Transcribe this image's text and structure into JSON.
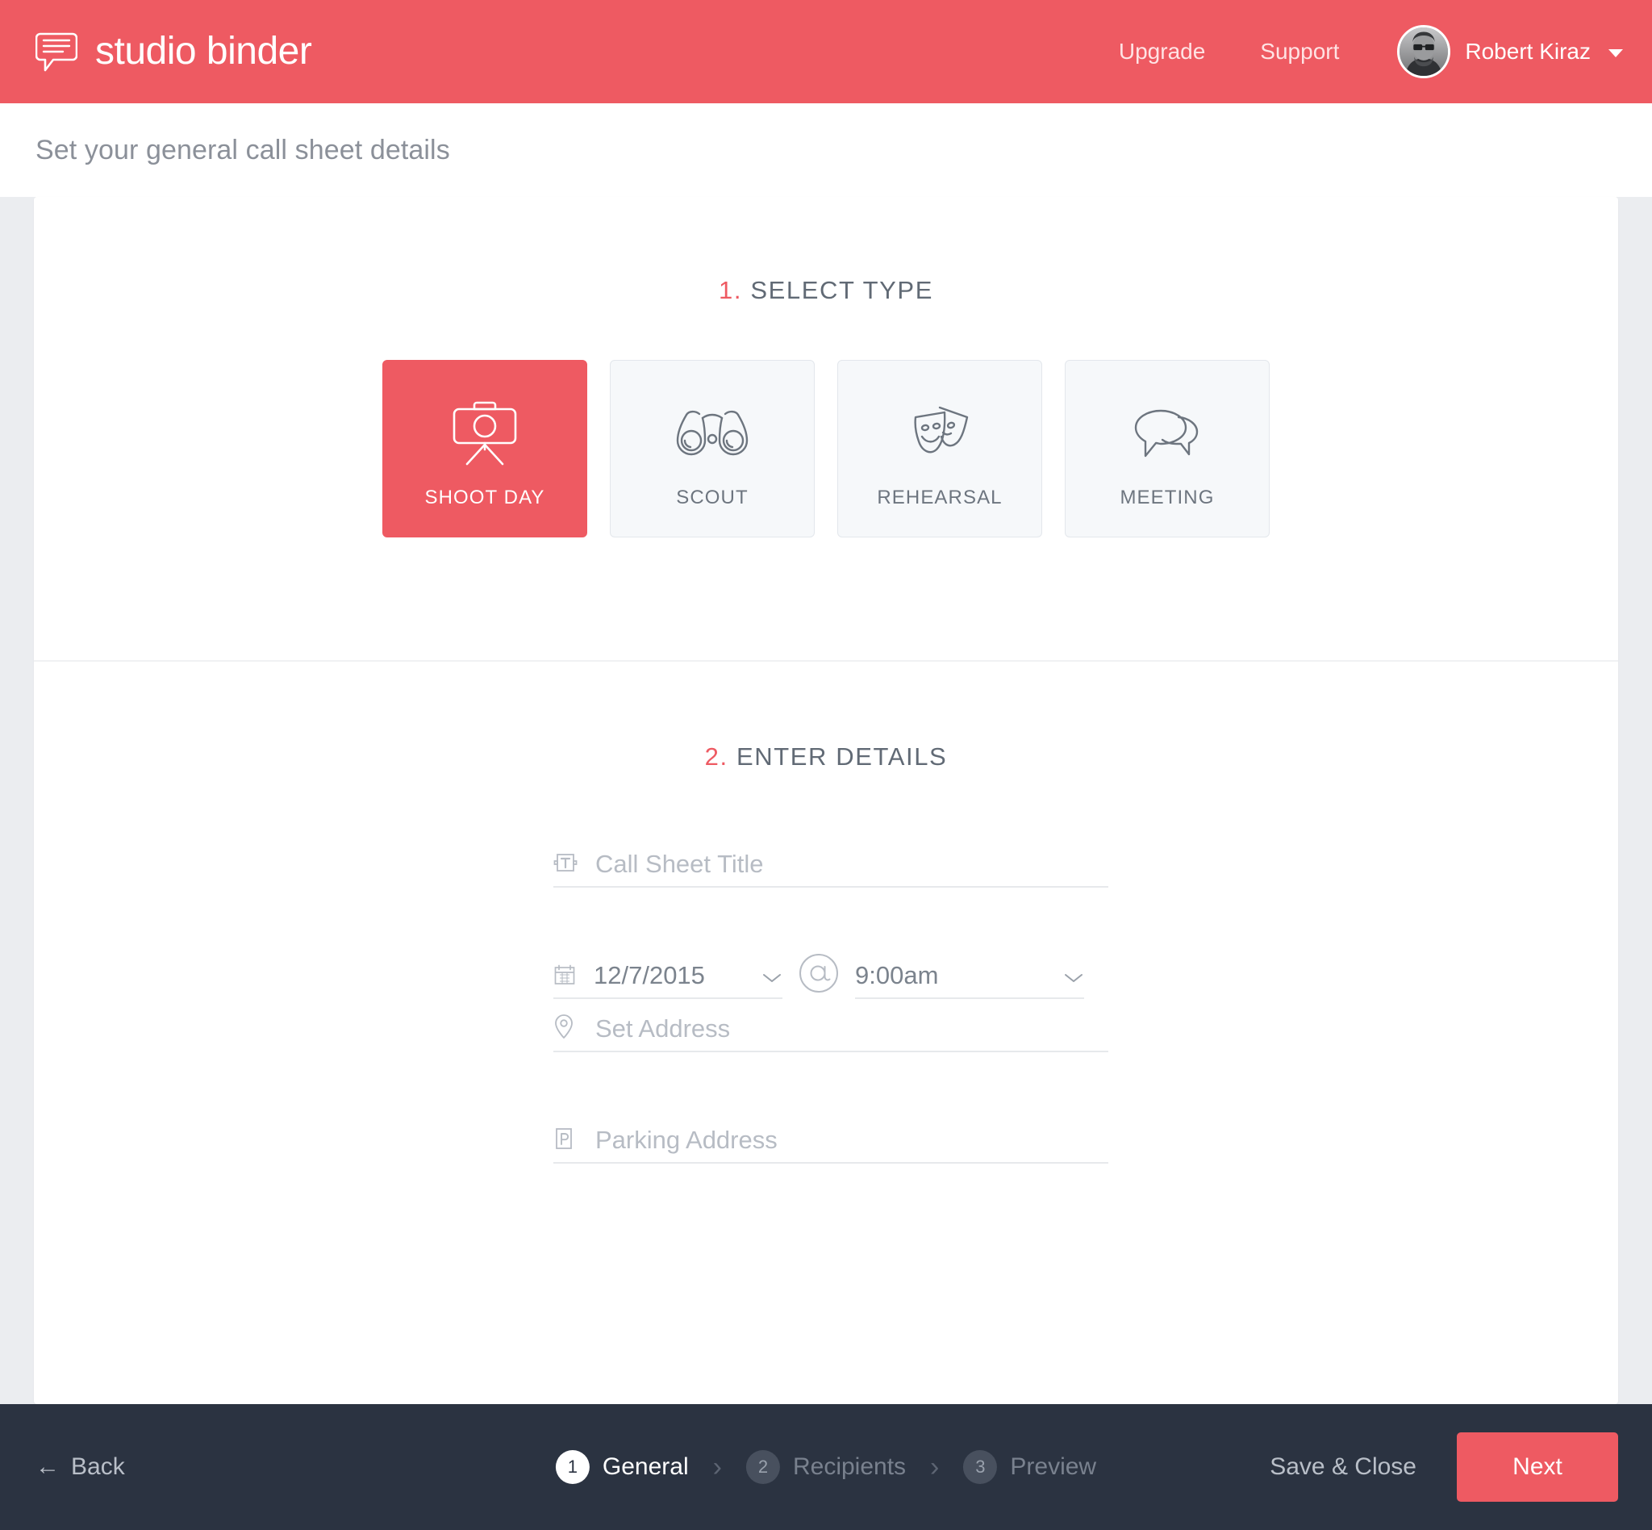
{
  "brand": {
    "name": "studio binder",
    "logo_icon": "speech-bubble-lines-logo"
  },
  "topnav": {
    "upgrade": "Upgrade",
    "support": "Support",
    "user_name": "Robert Kiraz",
    "avatar_icon": "user-avatar-photo",
    "caret_icon": "chevron-down-icon"
  },
  "subheader": {
    "title": "Set your general call sheet details"
  },
  "section_one": {
    "number": "1.",
    "title": "SELECT TYPE",
    "types": [
      {
        "label": "SHOOT DAY",
        "icon": "camera-tripod-icon",
        "selected": true
      },
      {
        "label": "SCOUT",
        "icon": "binoculars-icon",
        "selected": false
      },
      {
        "label": "REHEARSAL",
        "icon": "theater-masks-icon",
        "selected": false
      },
      {
        "label": "MEETING",
        "icon": "speech-bubbles-icon",
        "selected": false
      }
    ]
  },
  "section_two": {
    "number": "2.",
    "title": "ENTER DETAILS",
    "fields": {
      "call_sheet_title": {
        "placeholder": "Call Sheet Title",
        "value": "",
        "icon": "text-field-icon"
      },
      "date": {
        "value": "12/7/2015",
        "icon": "calendar-icon",
        "chevron": "chevron-down-icon"
      },
      "at": {
        "symbol": "@",
        "icon": "at-symbol-icon"
      },
      "time": {
        "value": "9:00am",
        "chevron": "chevron-down-icon"
      },
      "set_address": {
        "placeholder": "Set Address",
        "value": "",
        "icon": "map-pin-icon"
      },
      "parking_address": {
        "placeholder": "Parking Address",
        "value": "",
        "icon": "parking-p-icon"
      }
    }
  },
  "footer": {
    "back": "Back",
    "back_arrow": "←",
    "steps": [
      {
        "num": "1",
        "label": "General",
        "active": true
      },
      {
        "num": "2",
        "label": "Recipients",
        "active": false
      },
      {
        "num": "3",
        "label": "Preview",
        "active": false
      }
    ],
    "separator": "›",
    "save_close": "Save & Close",
    "next": "Next"
  },
  "colors": {
    "accent": "#ee5a62",
    "footer_bg": "#2b3341",
    "page_bg": "#ebedf0",
    "card_bg": "#ffffff",
    "type_card_bg": "#f6f8fa",
    "muted_text": "#8b9099",
    "placeholder": "#b7bcc4"
  }
}
